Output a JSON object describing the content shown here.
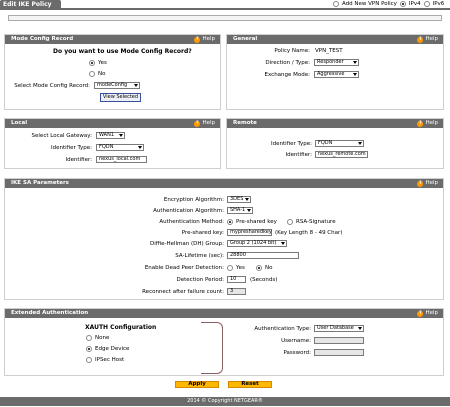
{
  "tab": {
    "title": "Edit IKE Policy"
  },
  "header": {
    "add_new": "Add New VPN Policy",
    "ipv4": "IPv4",
    "ipv6": "IPv6"
  },
  "help_label": "Help",
  "mode_config": {
    "title": "Mode Config Record",
    "question": "Do you want to use Mode Config Record?",
    "yes": "Yes",
    "no": "No",
    "select_label": "Select Mode Config Record:",
    "select_value": "modeConfig",
    "view_button": "View Selected"
  },
  "general": {
    "title": "General",
    "policy_name_label": "Policy Name:",
    "policy_name_value": "VPN_TEST",
    "direction_label": "Direction / Type:",
    "direction_value": "Responder",
    "exchange_label": "Exchange Mode:",
    "exchange_value": "Aggressive"
  },
  "local": {
    "title": "Local",
    "gateway_label": "Select Local Gateway:",
    "gateway_value": "WAN1",
    "id_type_label": "Identifier Type:",
    "id_type_value": "FQDN",
    "identifier_label": "Identifier:",
    "identifier_value": "nexus_local.com"
  },
  "remote": {
    "title": "Remote",
    "id_type_label": "Identifier Type:",
    "id_type_value": "FQDN",
    "identifier_label": "Identifier:",
    "identifier_value": "nexus_remote.com"
  },
  "ike_sa": {
    "title": "IKE SA Parameters",
    "enc_label": "Encryption Algorithm:",
    "enc_value": "3DES",
    "auth_alg_label": "Authentication Algorithm:",
    "auth_alg_value": "SHA-1",
    "auth_method_label": "Authentication Method:",
    "auth_psk": "Pre-shared key",
    "auth_rsa": "RSA-Signature",
    "psk_label": "Pre-shared key:",
    "psk_value": "mypresharedkey",
    "psk_hint": "(Key Length 8 - 49 Char)",
    "dh_label": "Diffie-Hellman (DH) Group:",
    "dh_value": "Group 2 (1024 bit)",
    "lifetime_label": "SA-Lifetime (sec):",
    "lifetime_value": "28800",
    "dpd_label": "Enable Dead Peer Detection:",
    "dpd_yes": "Yes",
    "dpd_no": "No",
    "period_label": "Detection Period:",
    "period_value": "10",
    "period_unit": "(Seconds)",
    "reconnect_label": "Reconnect after failure count:",
    "reconnect_value": "3"
  },
  "xauth": {
    "title": "Extended Authentication",
    "config_title": "XAUTH Configuration",
    "none": "None",
    "edge": "Edge Device",
    "ipsec": "IPSec Host",
    "auth_type_label": "Authentication Type:",
    "auth_type_value": "User Database",
    "username_label": "Username:",
    "password_label": "Password:"
  },
  "actions": {
    "apply": "Apply",
    "reset": "Reset"
  },
  "footer": {
    "copyright": "2014 © Copyright NETGEAR®"
  }
}
